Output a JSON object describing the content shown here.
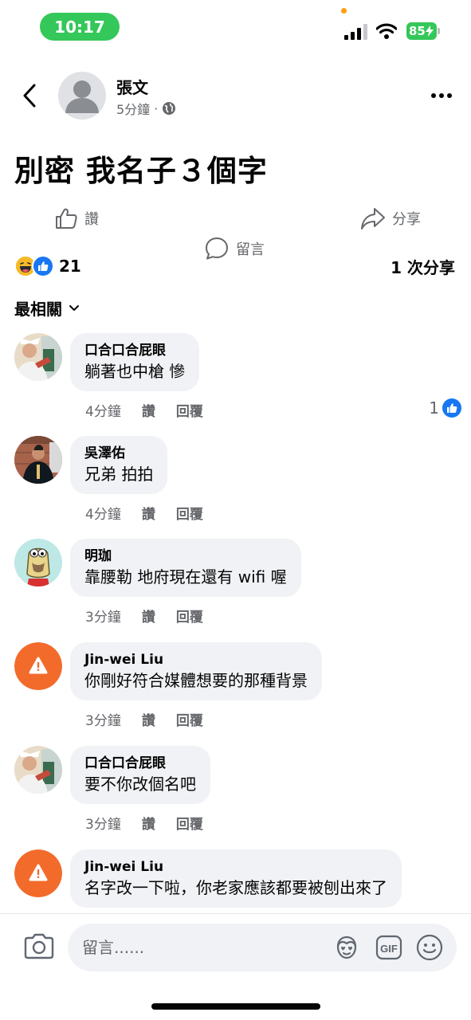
{
  "status_bar": {
    "time": "10:17",
    "battery": "85"
  },
  "post": {
    "author": "張文",
    "time": "5分鐘",
    "separator": "·",
    "text": "別密  我名子３個字"
  },
  "actions": {
    "like": "讚",
    "comment": "留言",
    "share": "分享"
  },
  "reactions": {
    "count": "21",
    "shares": "1 次分享"
  },
  "sort_label": "最相關",
  "comments": [
    {
      "name": "口合口合屁眼",
      "text": "躺著也中槍 慘",
      "time": "4分鐘",
      "like": "讚",
      "reply": "回覆",
      "likes": "1"
    },
    {
      "name": "吳澤佑",
      "text": "兄弟 拍拍",
      "time": "4分鐘",
      "like": "讚",
      "reply": "回覆"
    },
    {
      "name": "明珈",
      "text": "靠腰勒 地府現在還有 wifi 喔",
      "time": "3分鐘",
      "like": "讚",
      "reply": "回覆"
    },
    {
      "name": "Jin-wei Liu",
      "text": "你剛好符合媒體想要的那種背景",
      "time": "3分鐘",
      "like": "讚",
      "reply": "回覆"
    },
    {
      "name": "口合口合屁眼",
      "text": "要不你改個名吧",
      "time": "3分鐘",
      "like": "讚",
      "reply": "回覆"
    },
    {
      "name": "Jin-wei Liu",
      "text": "名字改一下啦，你老家應該都要被刨出來了"
    }
  ],
  "composer": {
    "placeholder": "留言......",
    "gif_label": "GIF"
  },
  "colors": {
    "accent": "#1877f2",
    "status_green": "#34c759",
    "bubble": "#f0f2f5",
    "warning_avatar": "#f26b2b"
  }
}
